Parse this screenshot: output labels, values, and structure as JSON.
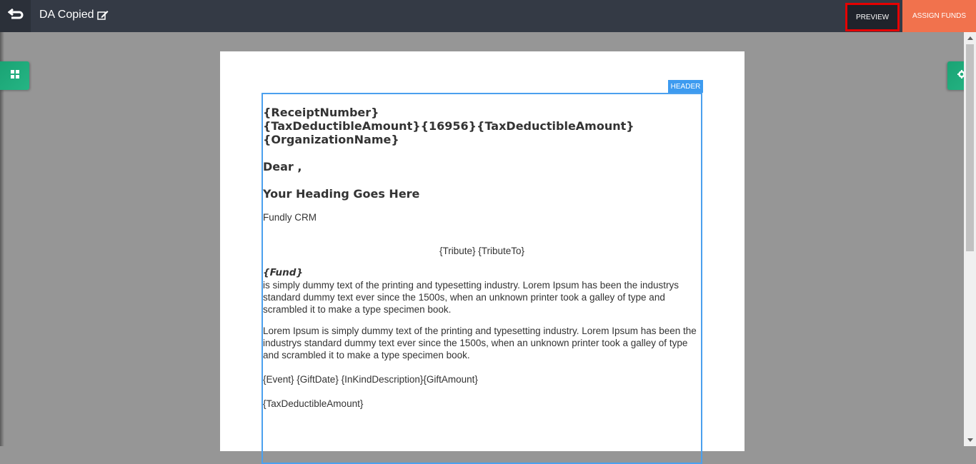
{
  "topbar": {
    "title": "DA Copied",
    "back_icon": "back-arrow-icon",
    "edit_icon": "edit-icon",
    "preview_label": "PREVIEW",
    "assign_label": "ASSIGN FUNDS"
  },
  "side": {
    "left_icon": "grid-icon",
    "right_icon": "gear-icon"
  },
  "document": {
    "header_label": "HEADER",
    "line1": "{ReceiptNumber}",
    "line2": "{TaxDeductibleAmount}{16956}{TaxDeductibleAmount}",
    "line3": "{OrganizationName}",
    "dear": "Dear ,",
    "heading": "Your Heading Goes Here",
    "org": "Fundly CRM",
    "tribute": "{Tribute} {TributeTo}",
    "fund": "{Fund}",
    "para1": "is simply dummy text of the printing and typesetting industry. Lorem Ipsum has been the industrys standard dummy text ever since the 1500s, when an unknown printer took a galley of type and scrambled it to make a type specimen book.",
    "para2": "Lorem Ipsum is simply dummy text of the printing and typesetting industry. Lorem Ipsum has been the industrys standard dummy text ever since the 1500s, when an unknown printer took a galley of type and scrambled it to make a type specimen book.",
    "gift_line": "{Event} {GiftDate} {InKindDescription}{GiftAmount}",
    "tax_line": "{TaxDeductibleAmount}"
  },
  "colors": {
    "topbar": "#343a45",
    "assign": "#f1724d",
    "accent_green": "#1aa374",
    "header_blue": "#3d9bf0",
    "highlight_red": "#e60000"
  }
}
